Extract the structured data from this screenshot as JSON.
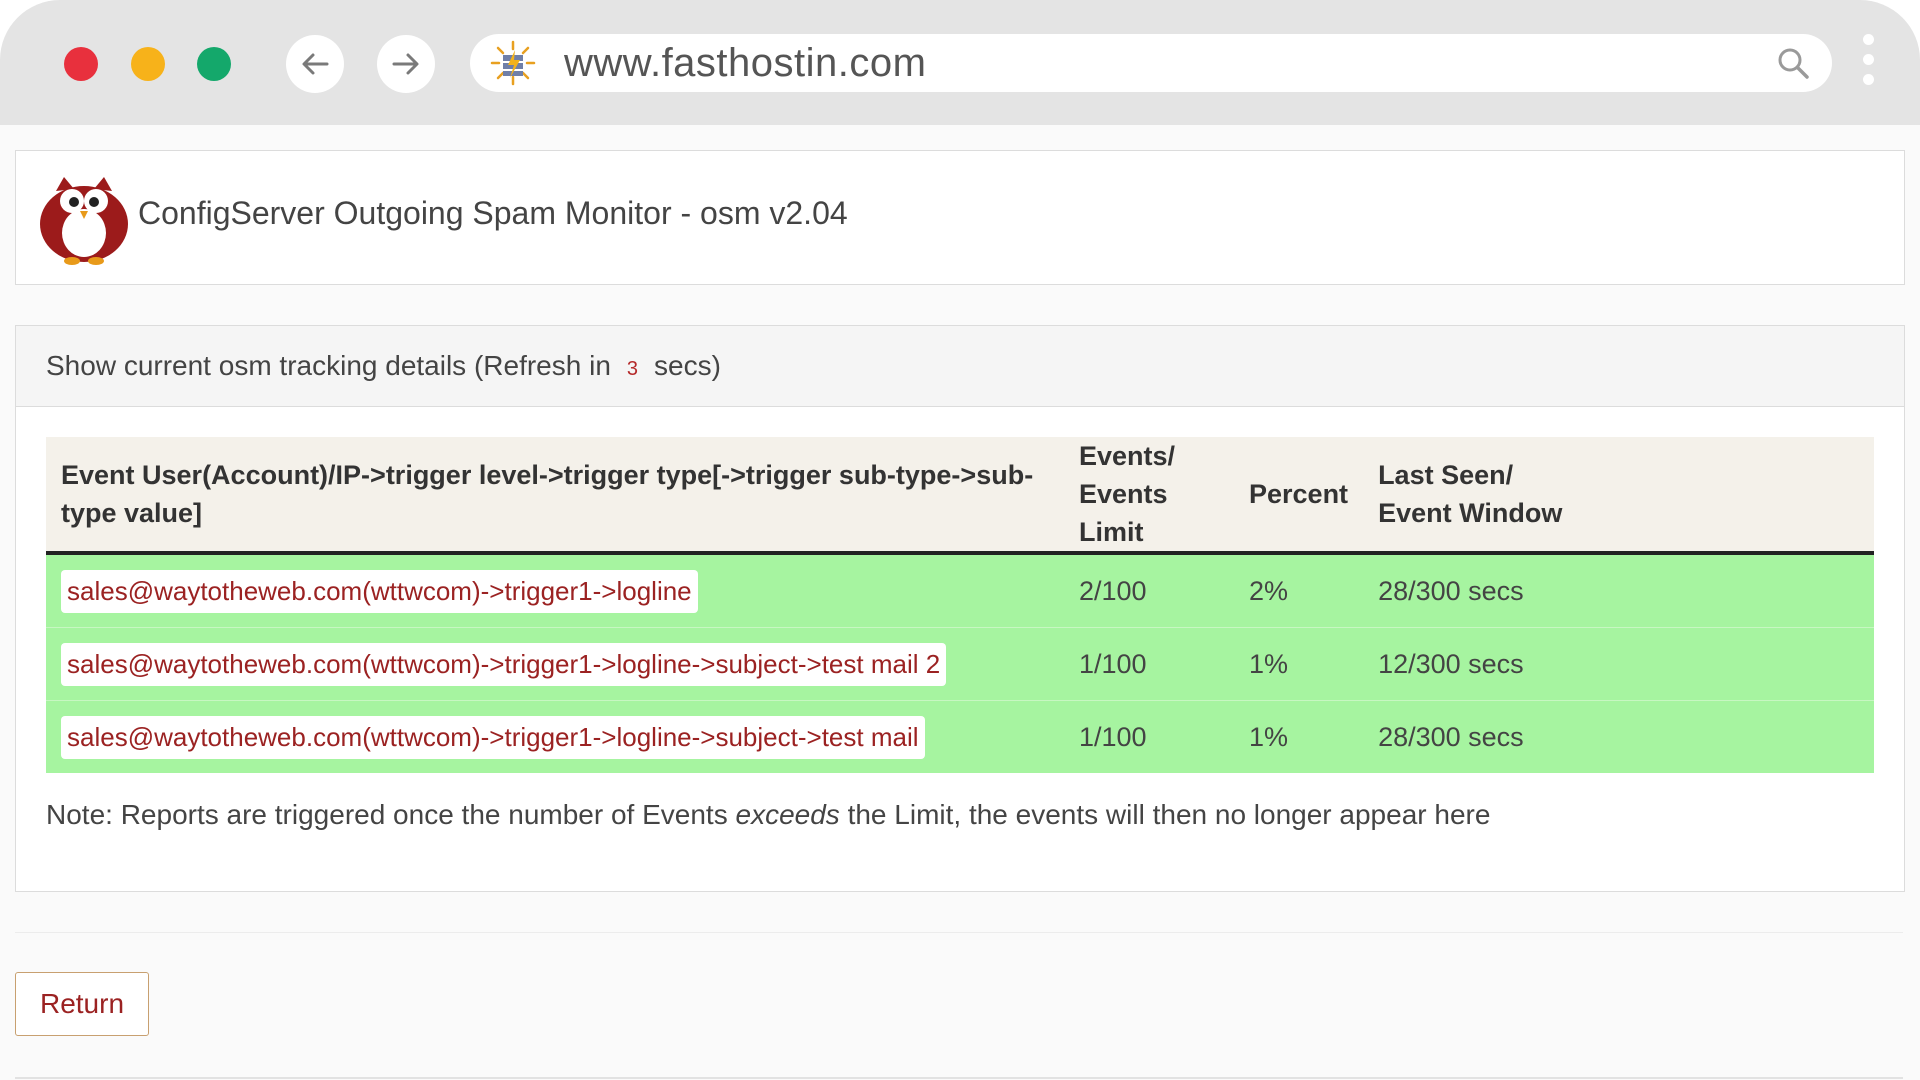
{
  "browser": {
    "url": "www.fasthostin.com",
    "icons": {
      "back": "arrow-left-icon",
      "forward": "arrow-right-icon",
      "search": "search-icon",
      "menu": "kebab-menu-icon"
    },
    "colors": {
      "close": "#e8303d",
      "minimize": "#f7b21a",
      "maximize": "#14a86b"
    }
  },
  "app": {
    "title": "ConfigServer Outgoing Spam Monitor - osm v2.04",
    "logo": "owl-logo"
  },
  "panel": {
    "heading_prefix": "Show current osm tracking details (Refresh in",
    "refresh_count": "3",
    "heading_suffix": "secs)"
  },
  "table": {
    "headers": {
      "event": "Event User(Account)/IP->trigger level->trigger type[->trigger sub-type->sub-type value]",
      "events_line1": "Events/",
      "events_line2": "Events Limit",
      "percent": "Percent",
      "last_line1": "Last Seen/",
      "last_line2": "Event Window"
    },
    "rows": [
      {
        "event": "sales@waytotheweb.com(wttwcom)->trigger1->logline",
        "events": "2/100",
        "percent": "2%",
        "last_seen": "28/300 secs"
      },
      {
        "event": "sales@waytotheweb.com(wttwcom)->trigger1->logline->subject->test mail 2",
        "events": "1/100",
        "percent": "1%",
        "last_seen": "12/300 secs"
      },
      {
        "event": "sales@waytotheweb.com(wttwcom)->trigger1->logline->subject->test mail",
        "events": "1/100",
        "percent": "1%",
        "last_seen": "28/300 secs"
      }
    ],
    "row_color": "#a6f4a0"
  },
  "note": {
    "before": "Note: Reports are triggered once the number of Events ",
    "emphasis": "exceeds",
    "after": " the Limit, the events will then no longer appear here"
  },
  "return_label": "Return"
}
